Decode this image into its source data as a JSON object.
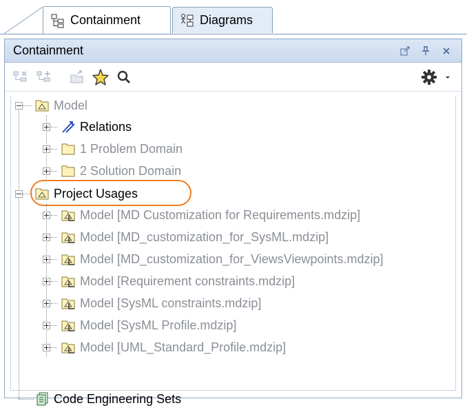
{
  "tabs": [
    {
      "label": "Containment",
      "icon": "containment-tree-icon",
      "active": true
    },
    {
      "label": "Diagrams",
      "icon": "diagrams-icon",
      "active": false
    }
  ],
  "panel": {
    "title": "Containment",
    "header_buttons": [
      "undock-icon",
      "pin-icon",
      "close-icon"
    ]
  },
  "toolbar": {
    "buttons": [
      "collapse-all-icon",
      "expand-all-icon",
      "open-icon",
      "favorite-star-icon",
      "search-icon"
    ],
    "options_icon": "gear-icon",
    "options_arrow": "dropdown-arrow-icon"
  },
  "tree": {
    "model": {
      "label": "Model"
    },
    "relations": {
      "label": "Relations"
    },
    "problem_domain": {
      "label": "1 Problem Domain"
    },
    "solution_domain": {
      "label": "2 Solution Domain"
    },
    "project_usages": {
      "label": "Project Usages"
    },
    "usages": [
      {
        "label": "Model [MD Customization for Requirements.mdzip]"
      },
      {
        "label": "Model [MD_customization_for_SysML.mdzip]"
      },
      {
        "label": "Model [MD_customization_for_ViewsViewpoints.mdzip]"
      },
      {
        "label": "Model [Requirement constraints.mdzip]"
      },
      {
        "label": "Model [SysML constraints.mdzip]"
      },
      {
        "label": "Model [SysML Profile.mdzip]"
      },
      {
        "label": "Model [UML_Standard_Profile.mdzip]"
      }
    ],
    "code_engineering": {
      "label": "Code Engineering Sets"
    }
  },
  "colors": {
    "highlight": "#ef7d22",
    "dim_text": "#8a8f96",
    "header_bg": "#cad9ee"
  }
}
